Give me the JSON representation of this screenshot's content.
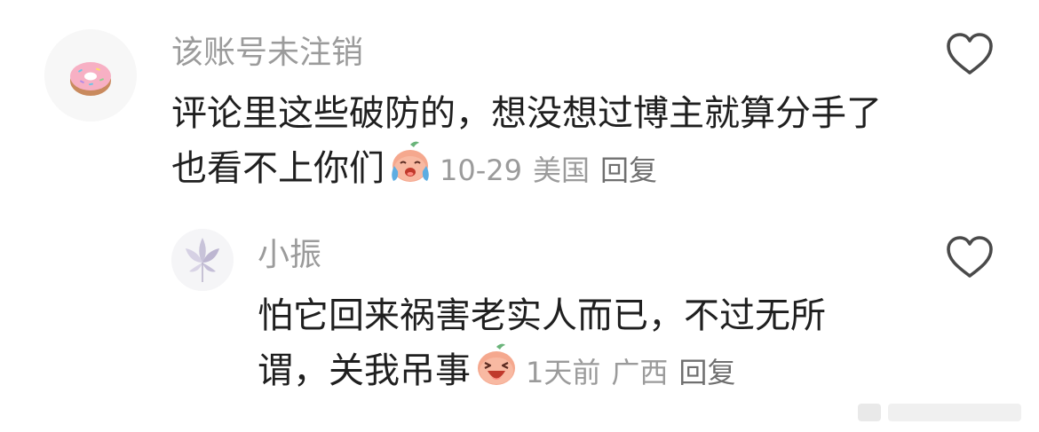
{
  "comment": {
    "username": "该账号未注销",
    "text": "评论里这些破防的，想没想过博主就算分手了也看不上你们",
    "emoji": "crying-face-emoji",
    "date": "10-29",
    "location": "美国",
    "reply_label": "回复"
  },
  "reply": {
    "username": "小振",
    "text": "怕它回来祸害老实人而已，不过无所谓，关我吊事",
    "emoji": "laughing-face-emoji",
    "date": "1天前",
    "location": "广西",
    "reply_label": "回复"
  },
  "icons": {
    "like": "heart-outline-icon",
    "avatar_main": "donut-icon",
    "avatar_reply": "flower-icon"
  },
  "colors": {
    "username": "#9b9b9b",
    "text": "#1f1f1f",
    "heart": "#4a4a4a",
    "emoji_face": "#f5a88e"
  }
}
